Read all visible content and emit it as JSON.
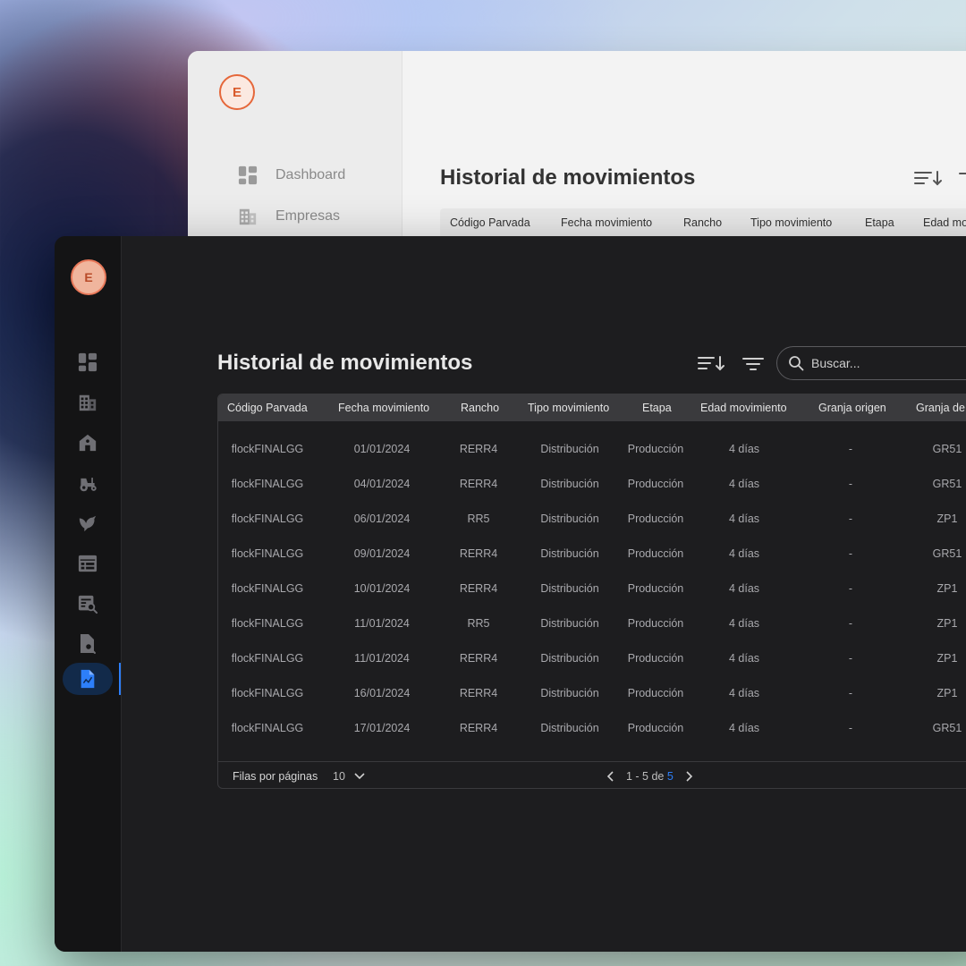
{
  "light_window": {
    "avatar_letter": "E",
    "nav": [
      {
        "label": "Dashboard",
        "icon": "dashboard-icon"
      },
      {
        "label": "Empresas",
        "icon": "building-icon"
      }
    ],
    "title": "Historial de movimientos",
    "columns": [
      "Código Parvada",
      "Fecha movimiento",
      "Rancho",
      "Tipo movimiento",
      "Etapa",
      "Edad mo"
    ]
  },
  "dark_window": {
    "avatar_letter": "E",
    "nav_icons": [
      "dashboard-icon",
      "building-icon",
      "farm-house-icon",
      "tractor-icon",
      "bird-icon",
      "table-icon",
      "report-search-icon",
      "document-search-icon",
      "document-chart-icon"
    ],
    "active_nav_index": 8,
    "title": "Historial de movimientos",
    "search": {
      "placeholder": "Buscar..."
    },
    "columns": [
      "Código Parvada",
      "Fecha movimiento",
      "Rancho",
      "Tipo movimiento",
      "Etapa",
      "Edad movimiento",
      "Granja origen",
      "Granja de"
    ],
    "rows": [
      [
        "flockFINALGG",
        "01/01/2024",
        "RERR4",
        "Distribución",
        "Producción",
        "4 días",
        "-",
        "GR51"
      ],
      [
        "flockFINALGG",
        "04/01/2024",
        "RERR4",
        "Distribución",
        "Producción",
        "4 días",
        "-",
        "GR51"
      ],
      [
        "flockFINALGG",
        "06/01/2024",
        "RR5",
        "Distribución",
        "Producción",
        "4 días",
        "-",
        "ZP1"
      ],
      [
        "flockFINALGG",
        "09/01/2024",
        "RERR4",
        "Distribución",
        "Producción",
        "4 días",
        "-",
        "GR51"
      ],
      [
        "flockFINALGG",
        "10/01/2024",
        "RERR4",
        "Distribución",
        "Producción",
        "4 días",
        "-",
        "ZP1"
      ],
      [
        "flockFINALGG",
        "11/01/2024",
        "RR5",
        "Distribución",
        "Producción",
        "4 días",
        "-",
        "ZP1"
      ],
      [
        "flockFINALGG",
        "11/01/2024",
        "RERR4",
        "Distribución",
        "Producción",
        "4 días",
        "-",
        "ZP1"
      ],
      [
        "flockFINALGG",
        "16/01/2024",
        "RERR4",
        "Distribución",
        "Producción",
        "4 días",
        "-",
        "ZP1"
      ],
      [
        "flockFINALGG",
        "17/01/2024",
        "RERR4",
        "Distribución",
        "Producción",
        "4 días",
        "-",
        "GR51"
      ]
    ],
    "footer": {
      "rows_label": "Filas por páginas",
      "rows_per_page": "10",
      "range_text": "1 - 5 de",
      "total_pages": "5"
    }
  },
  "colors": {
    "accent": "#2d7ff9",
    "avatar_orange": "#e5673a",
    "dark_bg": "#1d1d1f"
  }
}
